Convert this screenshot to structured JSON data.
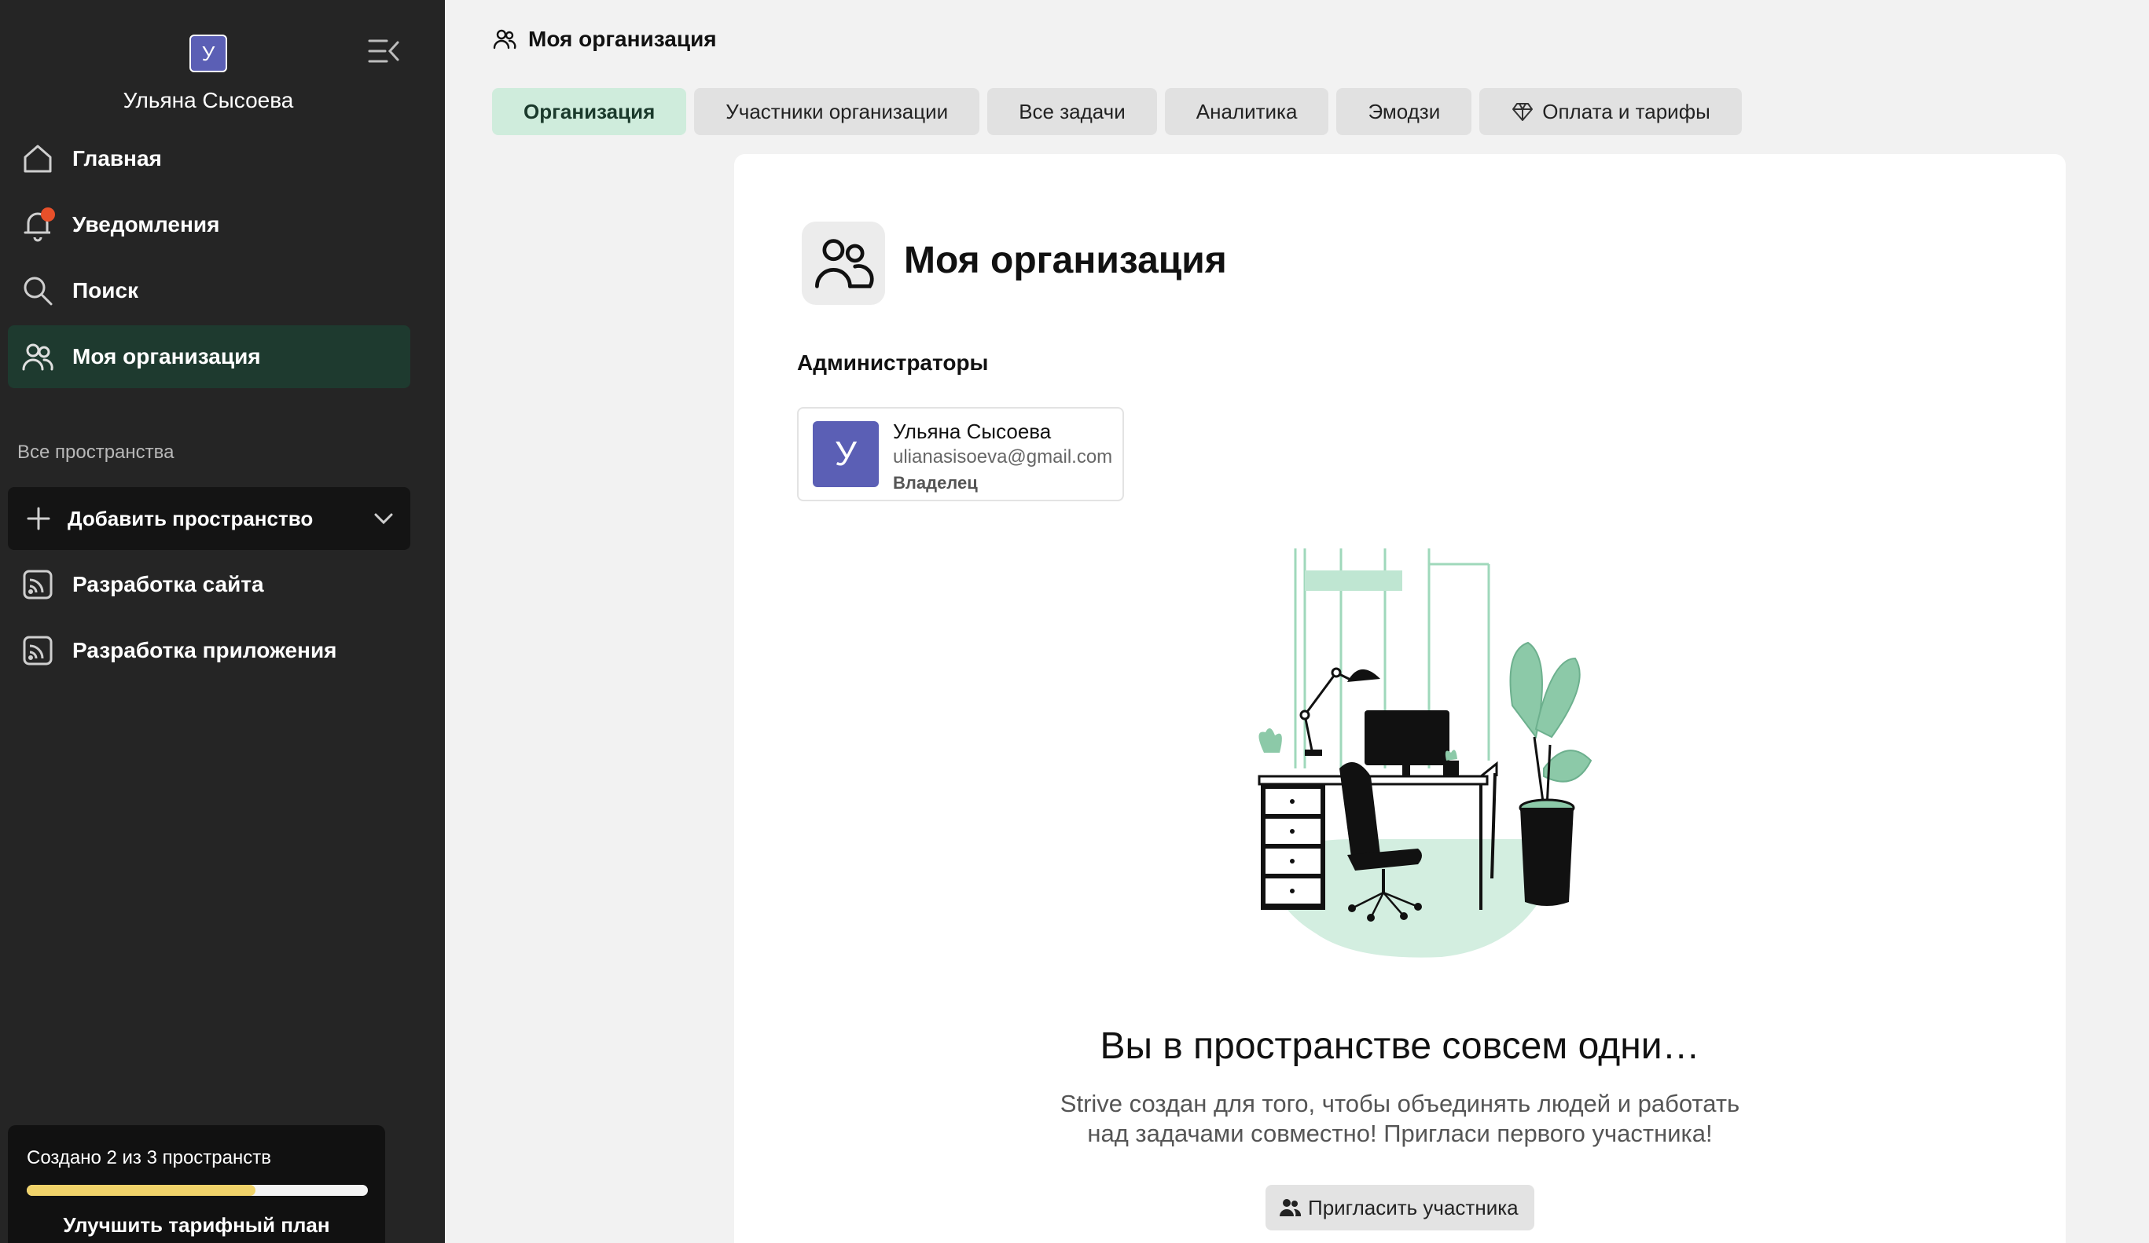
{
  "user": {
    "initial": "У",
    "name": "Ульяна Сысоева"
  },
  "sidebar": {
    "nav": [
      {
        "label": "Главная",
        "icon": "home-icon"
      },
      {
        "label": "Уведомления",
        "icon": "bell-icon",
        "has_badge": true
      },
      {
        "label": "Поиск",
        "icon": "search-icon"
      },
      {
        "label": "Моя организация",
        "icon": "users-icon",
        "active": true
      }
    ],
    "section_title": "Все пространства",
    "add_space_label": "Добавить пространство",
    "spaces": [
      {
        "label": "Разработка сайта",
        "icon": "rss-icon"
      },
      {
        "label": "Разработка приложения",
        "icon": "rss-icon"
      }
    ],
    "usage": {
      "text": "Создано 2 из 3 пространств",
      "progress": 0.67,
      "upgrade_label": "Улучшить тарифный план"
    }
  },
  "header": {
    "breadcrumb": "Моя организация"
  },
  "tabs": [
    {
      "label": "Организация",
      "active": true
    },
    {
      "label": "Участники организации"
    },
    {
      "label": "Все задачи"
    },
    {
      "label": "Аналитика"
    },
    {
      "label": "Эмодзи"
    },
    {
      "label": "Оплата и тарифы",
      "icon": "diamond-icon"
    }
  ],
  "main": {
    "title": "Моя организация",
    "admins_label": "Администраторы",
    "admin": {
      "initial": "У",
      "name": "Ульяна Сысоева",
      "email": "ulianasisoeva@gmail.com",
      "role": "Владелец"
    },
    "empty_title": "Вы в пространстве совсем одни…",
    "empty_desc_1": "Strive создан для того, чтобы объединять людей и работать",
    "empty_desc_2": "над задачами совместно! Пригласи первого участника!",
    "invite_label": "Пригласить участника"
  },
  "colors": {
    "sidebar_bg": "#252525",
    "accent_green": "#cfecdc",
    "active_nav": "#1e3a2f",
    "avatar": "#5b5fb5",
    "notification": "#e8502a",
    "progress": "#f0d36a"
  }
}
